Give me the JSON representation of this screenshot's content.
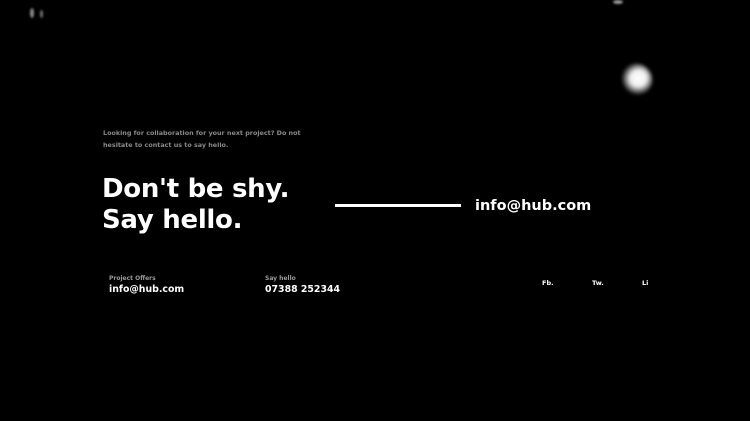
{
  "intro_text": "Looking for collaboration for your next project? Do not hesitate to contact us to say hello.",
  "headline": "Don't be shy. Say hello.",
  "cta_email": "info@hub.com",
  "contacts": [
    {
      "label": "Project Offers",
      "value": "info@hub.com"
    },
    {
      "label": "Say hello",
      "value": "07388 252344"
    }
  ],
  "social": [
    {
      "label": "Fb."
    },
    {
      "label": "Tw."
    },
    {
      "label": "Li"
    }
  ],
  "colors": {
    "background": "#000000",
    "text": "#ffffff",
    "muted": "#8a8a8a"
  }
}
